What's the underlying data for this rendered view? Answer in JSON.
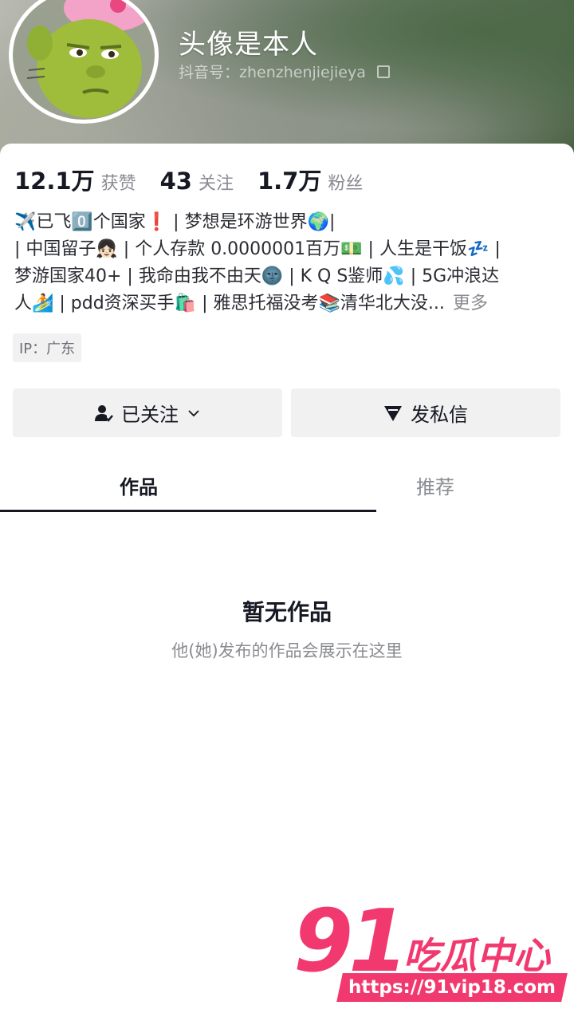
{
  "profile": {
    "nickname": "头像是本人",
    "douyin_id": "抖音号：zhenzhenjiejieya"
  },
  "stats": [
    {
      "value": "12.1万",
      "label": "获赞"
    },
    {
      "value": "43",
      "label": "关注"
    },
    {
      "value": "1.7万",
      "label": "粉丝"
    }
  ],
  "bio": {
    "line1": "✈️已飞0️⃣个国家❗️ | 梦想是环游世界🌍|",
    " line2": "",
    "line2": "| 中国留子👧🏻 | 个人存款 0.0000001百万💵 | 人生是干饭💤 |",
    "line3": "梦游国家40+ | 我命由我不由天🌚 | K Q S鉴师💦 | 5G冲浪达",
    "line4": "人🏄 | pdd资深买手🛍️ | 雅思托福没考📚清华北大没...",
    "more": "更多"
  },
  "ip": "IP：广东",
  "buttons": {
    "follow": "已关注",
    "message": "发私信"
  },
  "tabs": {
    "works": "作品",
    "recommend": "推荐"
  },
  "empty": {
    "title": "暂无作品",
    "subtitle": "他(她)发布的作品会展示在这里"
  },
  "watermark": {
    "number": "91",
    "name": "吃瓜中心",
    "url": "https://91vip18.com"
  },
  "colors": {
    "primary_text": "#161823",
    "secondary_text": "#8a8b91",
    "button_bg": "#f1f1f2",
    "watermark": "#f2396f"
  }
}
